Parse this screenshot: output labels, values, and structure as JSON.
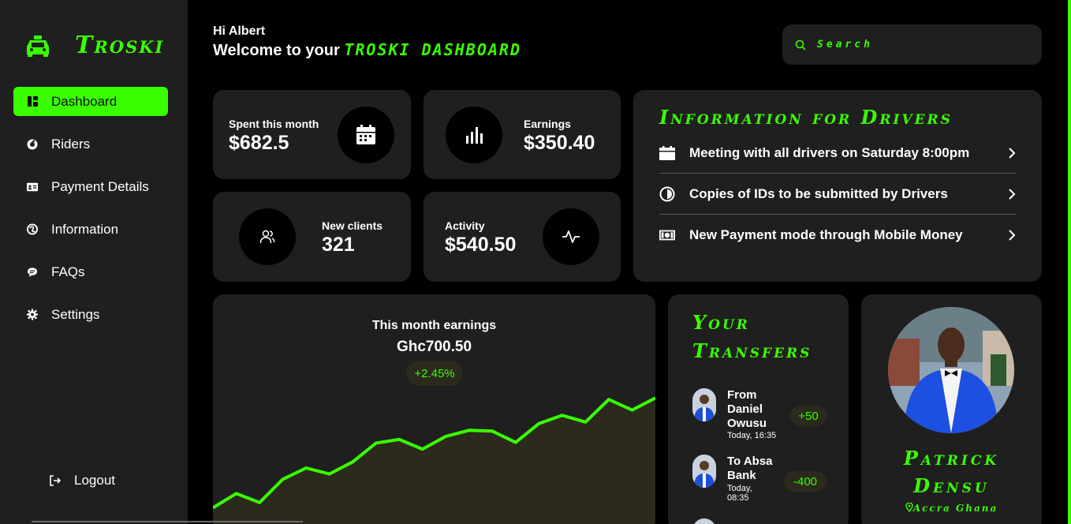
{
  "brand": {
    "name": "Troski",
    "icon": "taxi-icon"
  },
  "colors": {
    "accent": "#3aff00",
    "panel": "#1f1f1f",
    "background": "#000000"
  },
  "sidebar": {
    "items": [
      {
        "label": "Dashboard",
        "icon": "dashboard-icon",
        "active": true
      },
      {
        "label": "Riders",
        "icon": "riders-icon"
      },
      {
        "label": "Payment Details",
        "icon": "card-icon"
      },
      {
        "label": "Information",
        "icon": "info-icon"
      },
      {
        "label": "FAQs",
        "icon": "chat-icon"
      },
      {
        "label": "Settings",
        "icon": "gear-icon"
      }
    ],
    "logout": "Logout"
  },
  "header": {
    "greeting": "Hi Albert",
    "welcome": "Welcome to your",
    "welcome_brand": "TROSKI DASHBOARD",
    "search_placeholder": "Search"
  },
  "stats": {
    "spent": {
      "label": "Spent this month",
      "value": "$682.5"
    },
    "earnings": {
      "label": "Earnings",
      "value": "$350.40"
    },
    "clients": {
      "label": "New clients",
      "value": "321"
    },
    "activity": {
      "label": "Activity",
      "value": "$540.50"
    }
  },
  "info": {
    "title": "Information for Drivers",
    "items": [
      {
        "text": "Meeting with all drivers on Saturday 8:00pm",
        "icon": "calendar-icon"
      },
      {
        "text": "Copies of IDs to be submitted by Drivers",
        "icon": "clock-icon"
      },
      {
        "text": "New Payment mode through Mobile Money",
        "icon": "money-icon"
      }
    ]
  },
  "earnings_chart": {
    "title": "This month earnings",
    "amount": "Ghc700.50",
    "change": "+2.45%"
  },
  "chart_data": {
    "type": "area",
    "x": [
      1,
      2,
      3,
      4,
      5,
      6,
      7,
      8,
      9,
      10,
      11,
      12,
      13,
      14,
      15,
      16,
      17,
      18,
      19,
      20
    ],
    "y": [
      10,
      29,
      17,
      48,
      63,
      55,
      71,
      96,
      101,
      88,
      105,
      113,
      112,
      97,
      122,
      133,
      124,
      154,
      140,
      156
    ],
    "ylim": [
      0,
      170
    ]
  },
  "transfers": {
    "title": "Your Transfers",
    "items": [
      {
        "name": "From Daniel Owusu",
        "time": "Today, 16:35",
        "amount": "+50"
      },
      {
        "name": "To Absa Bank",
        "time": "Today, 08:35",
        "amount": "-400"
      }
    ]
  },
  "profile": {
    "name": "Patrick Densu",
    "location": "Accra Ghana"
  }
}
